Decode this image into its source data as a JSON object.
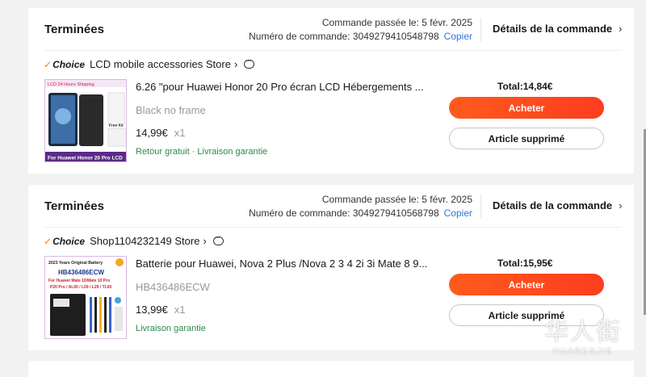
{
  "orders": [
    {
      "status": "Terminées",
      "date_line": "Commande passée le: 5 févr. 2025",
      "number_line": "Numéro de commande: 3049279410548798",
      "copy_label": "Copier",
      "details_label": "Détails de la commande",
      "choice_label": "Choice",
      "store": "LCD mobile accessories Store",
      "product_title": "6.26 \"pour Huawei Honor 20 Pro écran LCD Hébergements ...",
      "variant": "Black no frame",
      "price": "14,99€",
      "qty": "x1",
      "shipping": "Retour gratuit · Livraison garantie",
      "total": "Total:14,84€",
      "buy_label": "Acheter",
      "deleted_label": "Article supprimé",
      "thumb": {
        "top_banner": "LCD 24 Hours Shipping",
        "caption": "For Huawei Honor 20 Pro LCD",
        "badge": "Free Kit"
      }
    },
    {
      "status": "Terminées",
      "date_line": "Commande passée le: 5 févr. 2025",
      "number_line": "Numéro de commande: 3049279410568798",
      "copy_label": "Copier",
      "details_label": "Détails de la commande",
      "choice_label": "Choice",
      "store": "Shop1104232149 Store",
      "product_title": "Batterie pour Huawei, Nova 2 Plus /Nova 2 3 4 2i 3i Mate 8 9...",
      "variant": "HB436486ECW",
      "price": "13,99€",
      "qty": "x1",
      "shipping": "Livraison garantie",
      "total": "Total:15,95€",
      "buy_label": "Acheter",
      "deleted_label": "Article supprimé",
      "thumb": {
        "line1": "2023 Years Original Battery",
        "model": "HB436486ECW",
        "line3": "For Huawei Mate 10/Mate 10 Pro",
        "line4": "P20 Pro / AL00 / L09 / L29 / TL00"
      }
    }
  ],
  "watermark": {
    "big": "华人街",
    "small": "HUARENJIE"
  },
  "colors": {
    "accent": "#fd4c1e",
    "link": "#2e76d7",
    "shipping": "#2a8a4a"
  }
}
